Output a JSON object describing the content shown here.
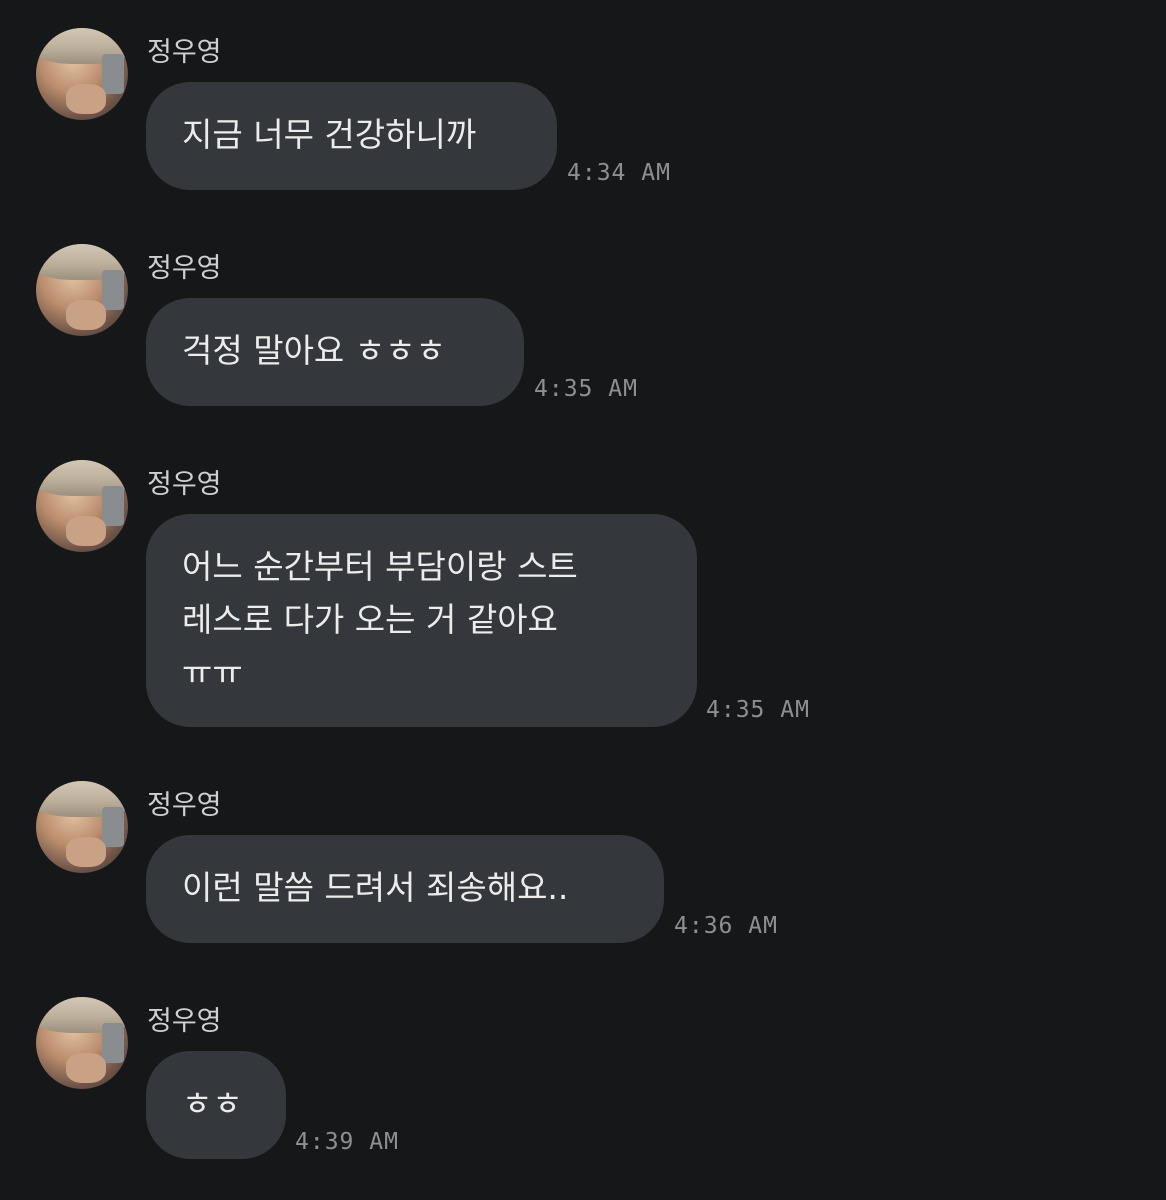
{
  "messages": [
    {
      "sender": "정우영",
      "text": "지금 너무 건강하니까",
      "time": "4:34 AM"
    },
    {
      "sender": "정우영",
      "text": "걱정 말아요 ㅎㅎㅎ",
      "time": "4:35 AM"
    },
    {
      "sender": "정우영",
      "text": "어느 순간부터 부담이랑 스트\n레스로 다가 오는 거 같아요\nㅠㅠ",
      "time": "4:35 AM"
    },
    {
      "sender": "정우영",
      "text": "이런 말씀 드려서 죄송해요..",
      "time": "4:36 AM"
    },
    {
      "sender": "정우영",
      "text": "ㅎㅎ",
      "time": "4:39 AM"
    }
  ]
}
